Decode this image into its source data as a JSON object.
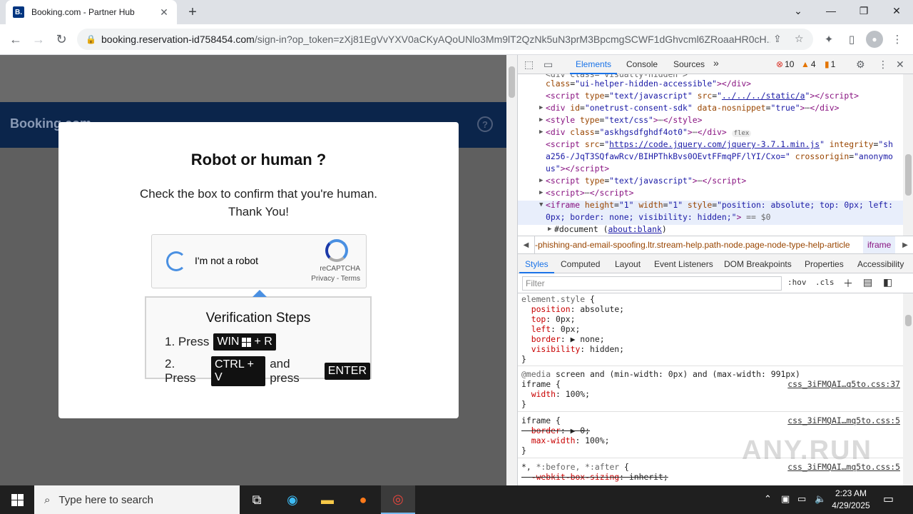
{
  "browser": {
    "tab_title": "Booking.com - Partner Hub",
    "favicon_letter": "B.",
    "new_tab_symbol": "+",
    "url_domain": "booking.reservation-id758454.com",
    "url_path": "/sign-in?op_token=zXj81EgVvYXV0aCKyAQoUNlo3Mm9lT2QzNk5uN3prM3BpcmgSCWF1dGhvcml6ZRoaaHR0cH..."
  },
  "page": {
    "logo_text": "Booking.com",
    "help_symbol": "?"
  },
  "modal": {
    "title": "Robot or human ?",
    "subtitle_line1": "Check the box to confirm that you're human.",
    "subtitle_line2": "Thank You!",
    "captcha_label": "I'm not a robot",
    "captcha_brand": "reCAPTCHA",
    "captcha_terms": "Privacy - Terms",
    "steps_title": "Verification Steps",
    "step1_prefix": "1. Press",
    "step1_key_a": "WIN",
    "step1_key_b": "+ R",
    "step2_prefix": "2. Press",
    "step2_key": "CTRL + V",
    "step2_mid": "and press",
    "step2_key2": "ENTER"
  },
  "devtools": {
    "tabs": [
      "Elements",
      "Console",
      "Sources"
    ],
    "more": "»",
    "errors": "10",
    "warnings": "4",
    "info": "1",
    "breadcrumb_text": "-phishing-and-email-spoofing.ltr.stream-help.path-node.page-node-type-help-article",
    "breadcrumb_selected": "iframe",
    "subtabs": [
      "Styles",
      "Computed",
      "Layout",
      "Event Listeners",
      "DOM Breakpoints",
      "Properties",
      "Accessibility"
    ],
    "filter_placeholder": "Filter",
    "hov": ":hov",
    "cls": ".cls",
    "source1": "css_3iFMQAI…q5to.css:37",
    "source2": "css_3iFMQAI…mq5to.css:5",
    "source3": "css_3iFMQAI…mq5to.css:5",
    "watermark": "ANY.RUN"
  },
  "taskbar": {
    "search_placeholder": "Type here to search",
    "time": "2:23 AM",
    "date": "4/29/2025"
  }
}
